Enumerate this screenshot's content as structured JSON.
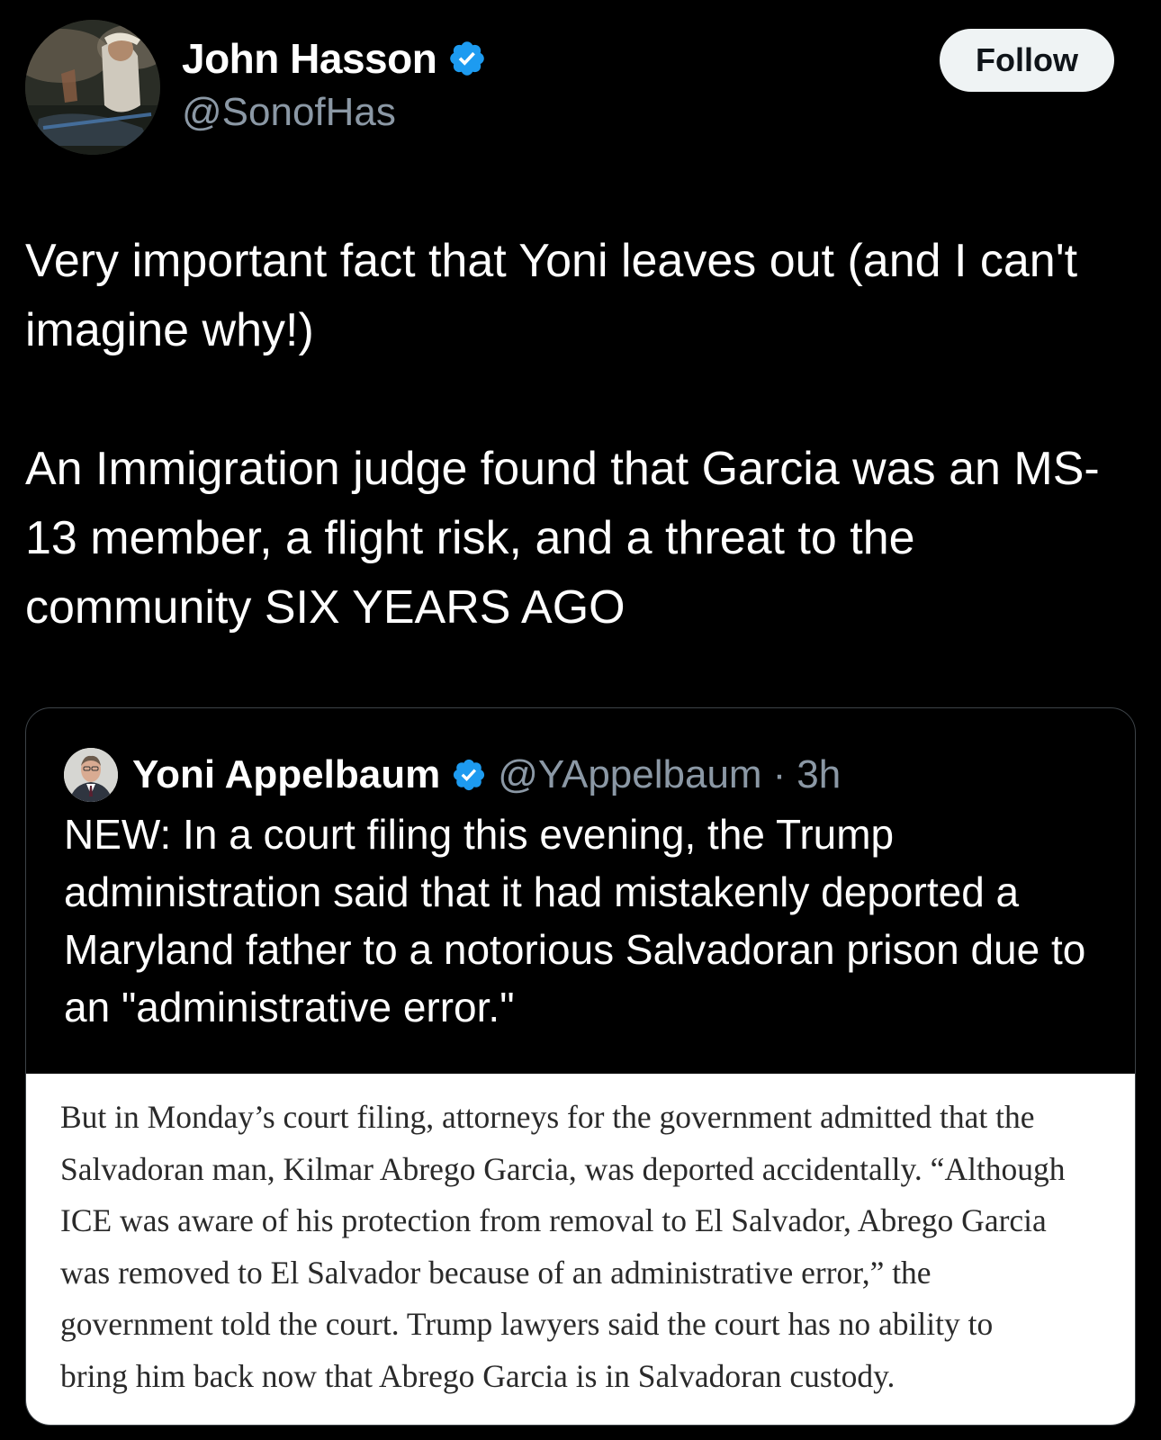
{
  "author": {
    "name": "John Hasson",
    "handle": "@SonofHas",
    "verified_color": "#1d9bf0"
  },
  "follow_label": "Follow",
  "post": {
    "paragraphs": [
      "Very important fact that Yoni leaves out (and I can't imagine why!)",
      "An Immigration judge found that Garcia was an MS-13 member, a flight risk, and a threat to the community SIX YEARS AGO"
    ]
  },
  "quote": {
    "name": "Yoni Appelbaum",
    "handle": "@YAppelbaum",
    "separator": "·",
    "time": "3h",
    "text": "NEW: In a court filing this evening, the Trump administration said that it had mistakenly deported a Maryland father to a notorious Salvadoran prison due to an \"administrative error.\"",
    "image_lines": [
      "But in Monday’s court filing, attorneys for the government admitted that the",
      "Salvadoran man, Kilmar Abrego Garcia, was deported accidentally. “Although",
      "ICE was aware of his protection from removal to El Salvador, Abrego Garcia",
      "was removed to El Salvador because of an administrative error,” the",
      "government told the court. Trump lawyers said the court has no ability to",
      "bring him back now that Abrego Garcia is in Salvadoran custody."
    ]
  },
  "colors": {
    "background": "#000000",
    "text": "#ffffff",
    "secondary": "#8b98a5",
    "border": "#3d4348",
    "verified": "#1d9bf0"
  }
}
